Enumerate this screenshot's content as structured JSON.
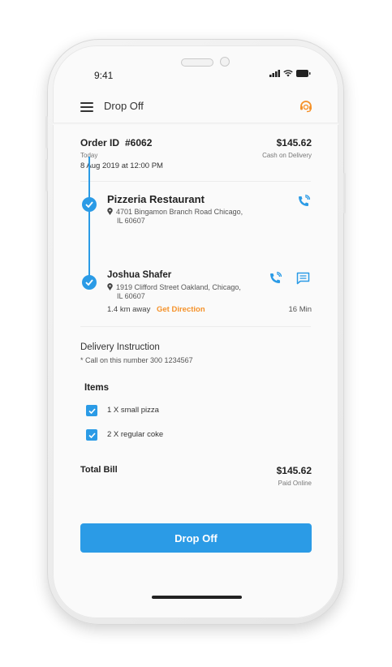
{
  "status_bar": {
    "time": "9:41"
  },
  "app_bar": {
    "title": "Drop Off"
  },
  "order": {
    "id_label": "Order ID",
    "id_value": "#6062",
    "amount": "$145.62",
    "day": "Today",
    "payment_method": "Cash on Delivery",
    "datetime": "8 Aug 2019 at 12:00 PM"
  },
  "pickup": {
    "name": "Pizzeria Restaurant",
    "address_line1": "4701 Bingamon Branch Road Chicago,",
    "address_line2": "IL 60607"
  },
  "dropoff": {
    "name": "Joshua Shafer",
    "address_line1": "1919 Clifford Street Oakland, Chicago,",
    "address_line2": "IL 60607",
    "distance": "1.4 km away",
    "direction_link": "Get Direction",
    "eta": "16 Min"
  },
  "delivery_instruction": {
    "heading": "Delivery Instruction",
    "text": "* Call on this number 300 1234567"
  },
  "items": {
    "heading": "Items",
    "list": [
      {
        "label": "1 X small pizza",
        "checked": true
      },
      {
        "label": "2 X regular coke",
        "checked": true
      }
    ]
  },
  "bill": {
    "label": "Total Bill",
    "amount": "$145.62",
    "status": "Paid Online"
  },
  "action": {
    "button_label": "Drop Off"
  },
  "colors": {
    "primary": "#2b9be6",
    "accent": "#f5922a",
    "text": "#222222",
    "muted": "#777777"
  }
}
